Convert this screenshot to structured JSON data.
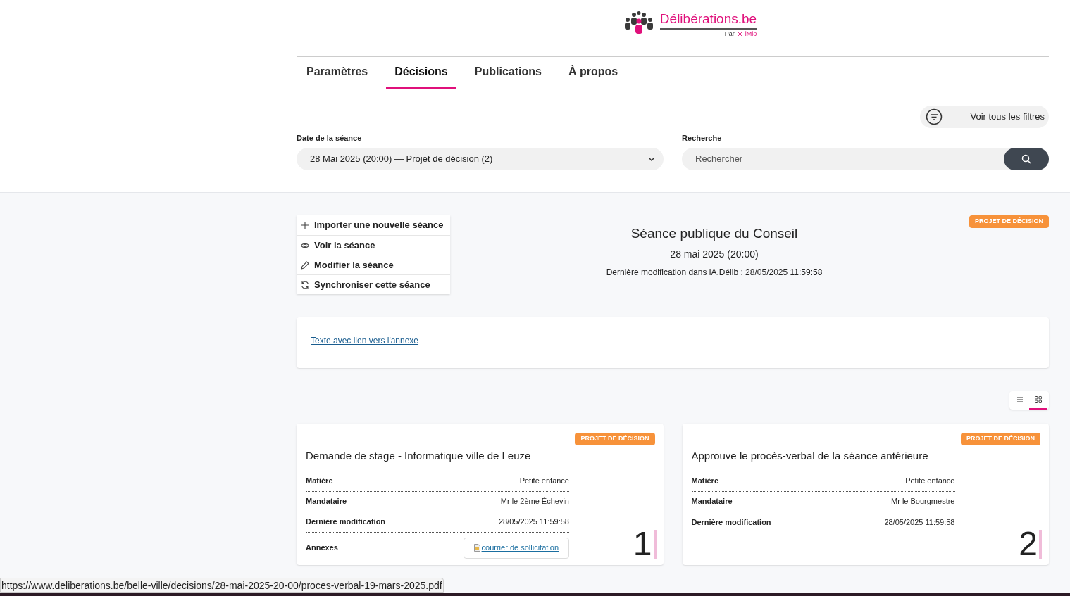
{
  "logo": {
    "name": "Délibérations.be",
    "by": "Par",
    "brand": "iMio"
  },
  "tabs": [
    {
      "label": "Paramètres",
      "selected": false
    },
    {
      "label": "Décisions",
      "selected": true
    },
    {
      "label": "Publications",
      "selected": false
    },
    {
      "label": "À propos",
      "selected": false
    }
  ],
  "filters_button": "Voir tous les filtres",
  "date_field": {
    "label": "Date de la séance",
    "value": "28 Mai 2025 (20:00) — Projet de décision (2)"
  },
  "search": {
    "label": "Recherche",
    "placeholder": "Rechercher"
  },
  "actions": [
    {
      "kind": "plus",
      "label": "Importer une nouvelle séance"
    },
    {
      "kind": "eye",
      "label": "Voir la séance"
    },
    {
      "kind": "pencil",
      "label": "Modifier la séance"
    },
    {
      "kind": "sync",
      "label": "Synchroniser cette séance"
    }
  ],
  "session": {
    "badge": "PROJET DE DÉCISION",
    "title": "Séance publique du Conseil",
    "date": "28 mai 2025 (20:00)",
    "modified": "Dernière modification dans iA.Délib : 28/05/2025 11:59:58"
  },
  "intro_link": "Texte avec lien vers l'annexe",
  "view_toggle": [
    {
      "kind": "list",
      "selected": false
    },
    {
      "kind": "grid",
      "selected": true
    }
  ],
  "cards": [
    {
      "badge": "PROJET DE DÉCISION",
      "title": "Demande de stage - Informatique ville de Leuze",
      "number": "1",
      "fields": [
        {
          "label": "Matière",
          "value": "Petite enfance"
        },
        {
          "label": "Mandataire",
          "value": "Mr le 2ème Échevin"
        },
        {
          "label": "Dernière modification",
          "value": "28/05/2025 11:59:58"
        }
      ],
      "annexes": {
        "label": "Annexes",
        "link": "courrier de sollicitation"
      }
    },
    {
      "badge": "PROJET DE DÉCISION",
      "title": "Approuve le procès-verbal de la séance antérieure",
      "number": "2",
      "fields": [
        {
          "label": "Matière",
          "value": "Petite enfance"
        },
        {
          "label": "Mandataire",
          "value": "Mr le Bourgmestre"
        },
        {
          "label": "Dernière modification",
          "value": "28/05/2025 11:59:58"
        }
      ]
    }
  ],
  "status_url": "https://www.deliberations.be/belle-ville/decisions/28-mai-2025-20-00/proces-verbal-19-mars-2025.pdf"
}
